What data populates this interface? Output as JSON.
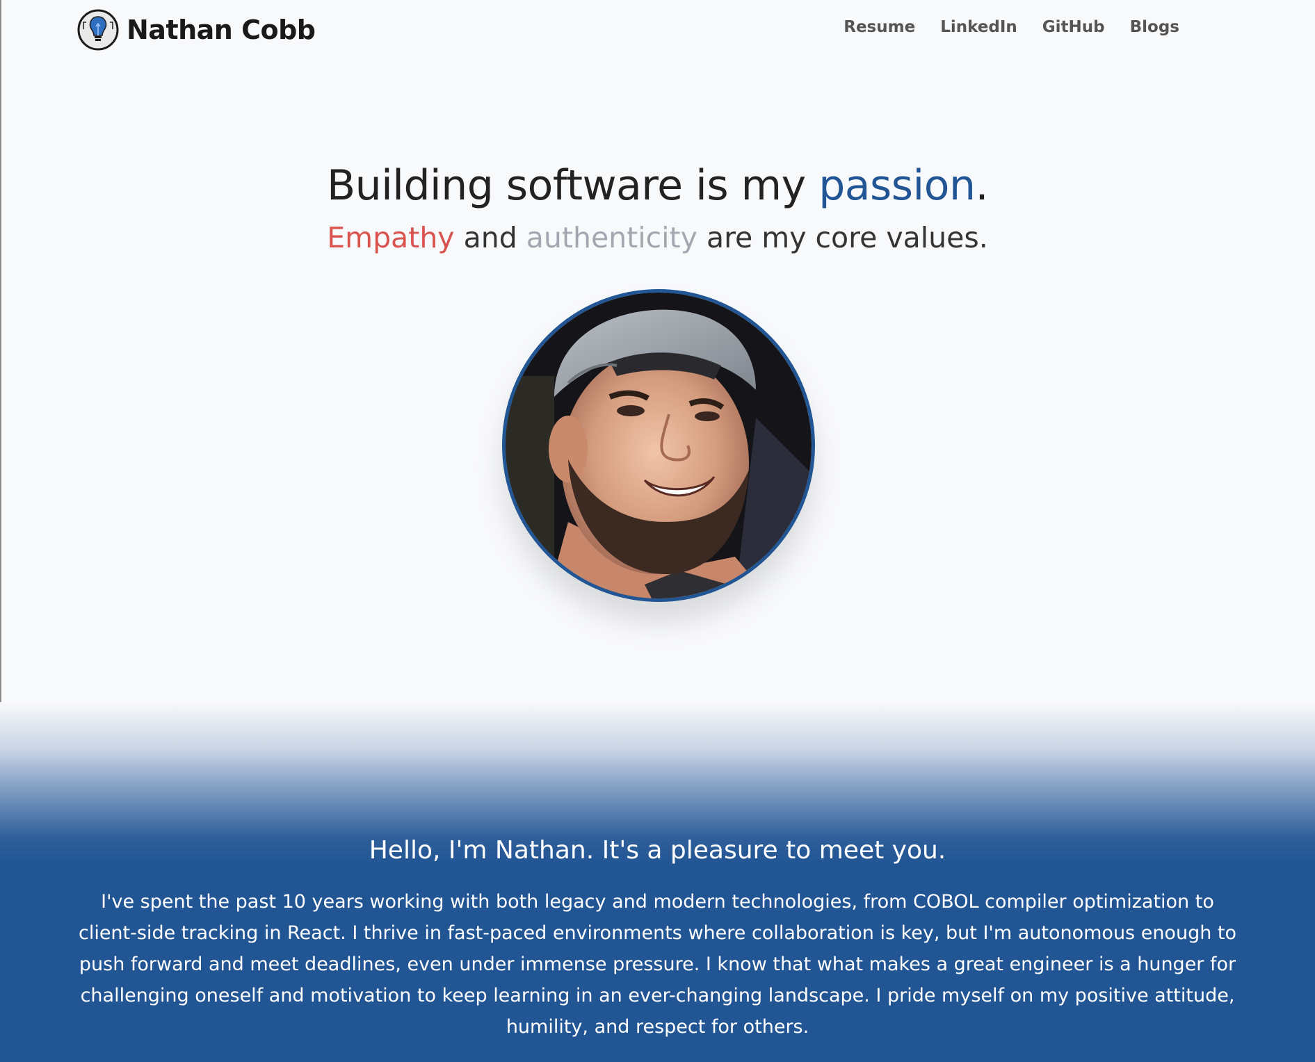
{
  "header": {
    "brand_name": "Nathan Cobb",
    "logo_icon": "lightbulb-icon",
    "nav": [
      {
        "label": "Resume"
      },
      {
        "label": "LinkedIn"
      },
      {
        "label": "GitHub"
      },
      {
        "label": "Blogs"
      }
    ]
  },
  "hero": {
    "title_prefix": "Building software is my ",
    "title_accent": "passion",
    "title_suffix": ".",
    "subtitle_word1": "Empathy",
    "subtitle_mid": " and ",
    "subtitle_word2": "authenticity",
    "subtitle_suffix": " are my core values.",
    "portrait_icon": "profile-photo"
  },
  "about": {
    "title": "Hello, I'm Nathan. It's a pleasure to meet you.",
    "body": "I've spent the past 10 years working with both legacy and modern technologies, from COBOL compiler optimization to client-side tracking in React. I thrive in fast-paced environments where collaboration is key, but I'm autonomous enough to push forward and meet deadlines, even under immense pressure. I know that what makes a great engineer is a hunger for challenging oneself and motivation to keep learning in an ever-changing landscape. I pride myself on my positive attitude, humility, and respect for others."
  },
  "colors": {
    "brand_blue": "#215594",
    "accent_red": "#d9534f",
    "accent_gray": "#a3a8b0",
    "background": "#f8f9fb"
  }
}
